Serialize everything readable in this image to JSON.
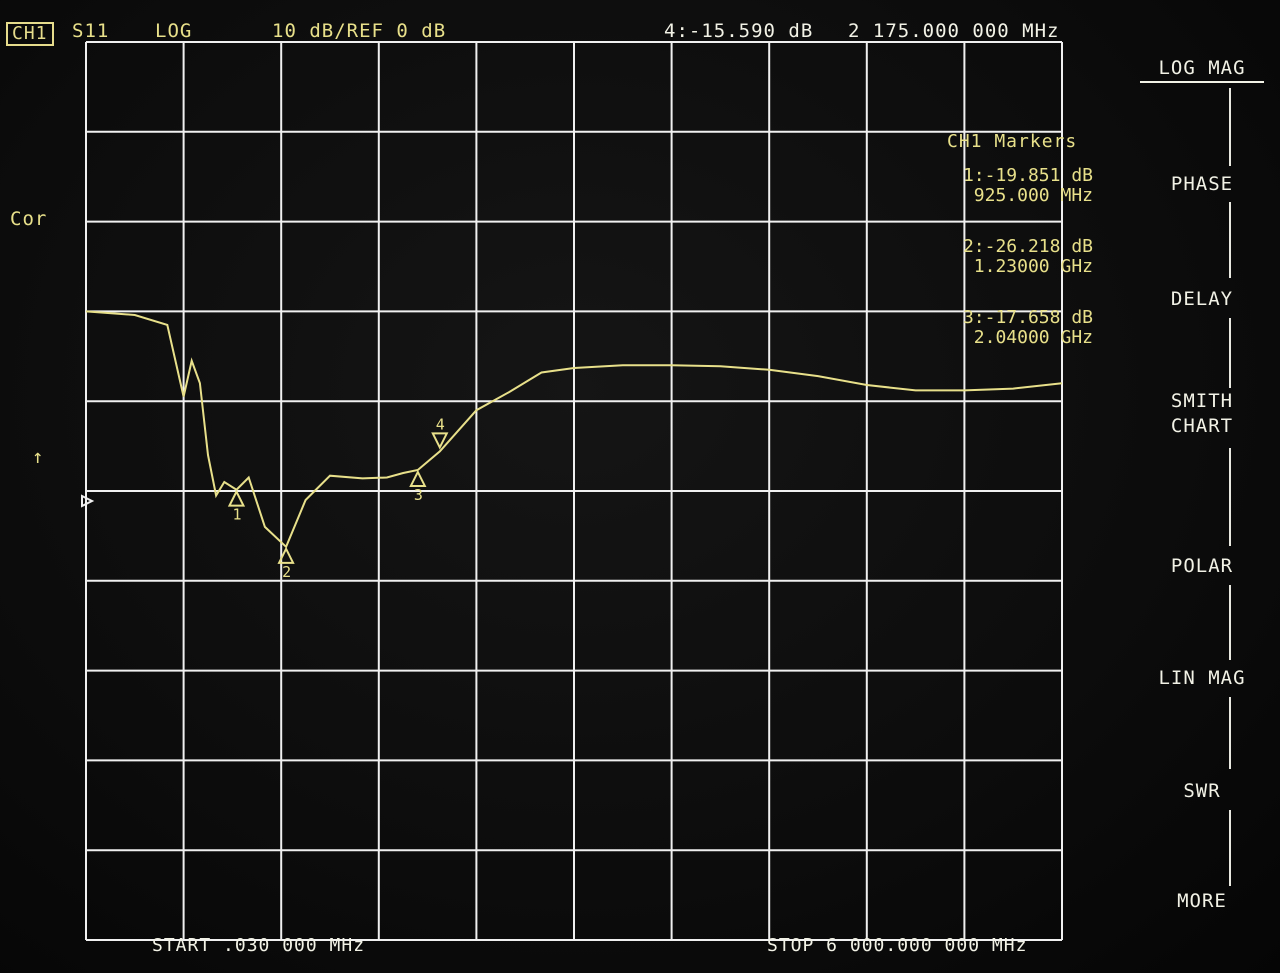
{
  "header": {
    "channel": "CH1",
    "parameter": "S11",
    "format": "LOG",
    "scale": "10 dB/REF 0 dB",
    "active_marker_readout": "4:-15.590 dB",
    "active_marker_freq": "2 175.000 000 MHz"
  },
  "left": {
    "correction": "Cor",
    "ref_arrow": "↑"
  },
  "markers_panel": {
    "title": "CH1 Markers",
    "markers": [
      {
        "value": "1:-19.851 dB",
        "freq": "925.000 MHz"
      },
      {
        "value": "2:-26.218 dB",
        "freq": "1.23000 GHz"
      },
      {
        "value": "3:-17.658 dB",
        "freq": "2.04000 GHz"
      }
    ]
  },
  "trace_marker_labels": [
    "1",
    "2",
    "3",
    "4"
  ],
  "softkeys": {
    "log_mag": "LOG MAG",
    "phase": "PHASE",
    "delay": "DELAY",
    "smith_1": "SMITH",
    "smith_2": "CHART",
    "polar": "POLAR",
    "lin_mag": "LIN MAG",
    "swr": "SWR",
    "more": "MORE"
  },
  "footer": {
    "start": "START  .030 000 MHz",
    "stop": "STOP 6 000.000 000 MHz"
  },
  "colors": {
    "trace": "#e8e08a",
    "grid": "#f0f0f0",
    "text": "#f2f2e6"
  },
  "chart_data": {
    "type": "line",
    "x_unit": "MHz",
    "y_unit": "dB",
    "xlim": [
      0.03,
      6000
    ],
    "ylim": [
      -70,
      30
    ],
    "grid": true,
    "series": [
      {
        "x": [
          0.03,
          300,
          500,
          600,
          650,
          700,
          750,
          800,
          850,
          925,
          1000,
          1100,
          1230,
          1350,
          1500,
          1700,
          1850,
          1950,
          2040,
          2175,
          2400,
          2600,
          2800,
          3000,
          3300,
          3600,
          3900,
          4200,
          4500,
          4800,
          5100,
          5400,
          5700,
          6000
        ],
        "y": [
          0.0,
          -0.4,
          -1.5,
          -9.5,
          -5.5,
          -8.0,
          -16.0,
          -20.5,
          -19.0,
          -19.851,
          -18.5,
          -24.0,
          -26.218,
          -21.0,
          -18.3,
          -18.6,
          -18.5,
          -18.0,
          -17.658,
          -15.59,
          -11.0,
          -9.0,
          -6.8,
          -6.3,
          -6.0,
          -6.0,
          -6.1,
          -6.5,
          -7.2,
          -8.2,
          -8.8,
          -8.8,
          -8.6,
          -8.0
        ]
      }
    ],
    "markers": [
      {
        "id": "1",
        "x": 925,
        "y": -19.851
      },
      {
        "id": "2",
        "x": 1230,
        "y": -26.218
      },
      {
        "id": "3",
        "x": 2040,
        "y": -17.658
      },
      {
        "id": "4",
        "x": 2175,
        "y": -15.59
      }
    ]
  }
}
